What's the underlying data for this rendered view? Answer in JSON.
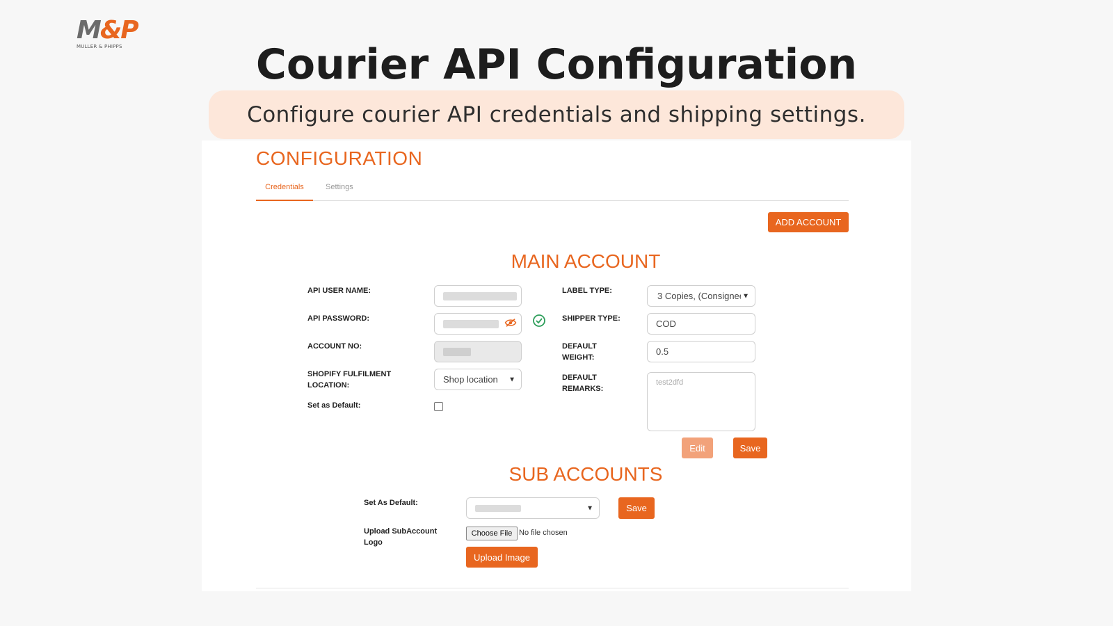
{
  "logo": {
    "mark_left": "M",
    "mark_amp": "&",
    "mark_right": "P",
    "subtext": "MULLER & PHIPPS"
  },
  "page": {
    "title": "Courier API Configuration",
    "subtitle": "Configure courier API credentials and shipping settings."
  },
  "config": {
    "title": "CONFIGURATION",
    "tabs": [
      {
        "label": "Credentials",
        "active": true
      },
      {
        "label": "Settings",
        "active": false
      }
    ],
    "add_account_label": "ADD ACCOUNT"
  },
  "main_account": {
    "title": "MAIN ACCOUNT",
    "api_user_name_label": "API USER NAME:",
    "api_password_label": "API PASSWORD:",
    "account_no_label": "ACCOUNT NO:",
    "shopify_location_label_1": "SHOPIFY FULFILMENT",
    "shopify_location_label_2": "LOCATION:",
    "shopify_location_value": "Shop location",
    "set_default_label": "Set as Default:",
    "label_type_label": "LABEL TYPE:",
    "label_type_value": "3 Copies, (Consignee",
    "shipper_type_label": "SHIPPER TYPE:",
    "shipper_type_value": "COD",
    "default_weight_label_1": "DEFAULT",
    "default_weight_label_2": "WEIGHT:",
    "default_weight_value": "0.5",
    "default_remarks_label_1": "DEFAULT",
    "default_remarks_label_2": "REMARKS:",
    "default_remarks_value": "test2dfd",
    "edit_label": "Edit",
    "save_label": "Save"
  },
  "sub_accounts": {
    "title": "SUB ACCOUNTS",
    "set_default_label": "Set As Default:",
    "save_label": "Save",
    "upload_logo_label_1": "Upload SubAccount",
    "upload_logo_label_2": "Logo",
    "choose_file_label": "Choose File",
    "no_file_text": "No file chosen",
    "upload_image_label": "Upload Image"
  },
  "colors": {
    "accent": "#e8661f",
    "accent_light": "#f2a27a",
    "pill_bg": "#fde7da",
    "success": "#2e9e5b"
  },
  "icons": [
    "eye-slash-icon",
    "check-circle-icon",
    "chevron-down-icon"
  ]
}
